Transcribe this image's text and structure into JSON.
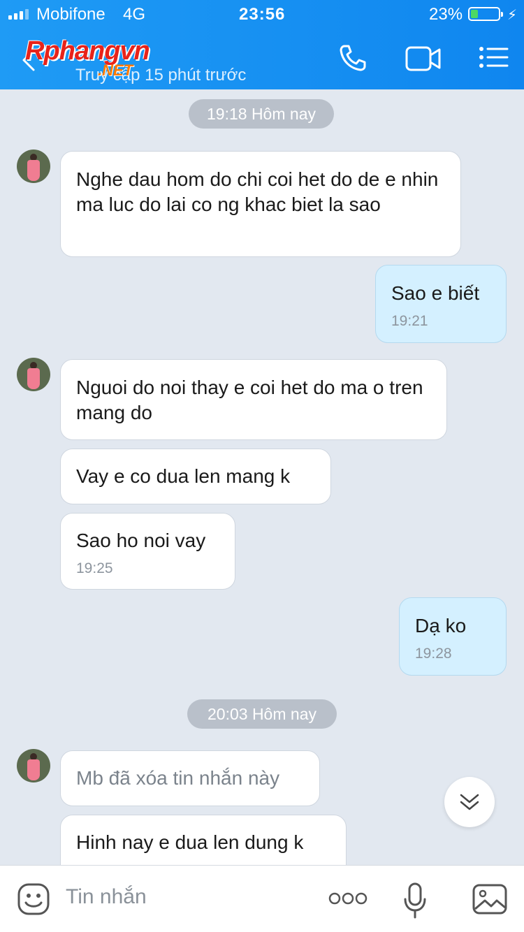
{
  "status": {
    "carrier": "Mobifone",
    "network": "4G",
    "time": "23:56",
    "battery": "23%"
  },
  "header": {
    "logo_main": "Rphangvn",
    "logo_sub": ".NET",
    "subtitle": "Truy cập 15 phút trước"
  },
  "messages": {
    "pill1": "19:18 Hôm nay",
    "m1": "Nghe dau hom do chi coi het do de e nhin ma luc do lai co ng khac biet la sao",
    "m2": "Sao e biết",
    "m2_time": "19:21",
    "m3": "Nguoi do noi thay e coi het do ma o tren mang do",
    "m4": "Vay e co dua len mang k",
    "m5": "Sao ho noi vay",
    "m5_time": "19:25",
    "m6": "Dạ ko",
    "m6_time": "19:28",
    "pill2": "20:03 Hôm nay",
    "m7": "Mb đã xóa tin nhắn này",
    "m8": "Hinh nay e dua len dung k"
  },
  "input": {
    "placeholder": "Tin nhắn"
  },
  "icons": {
    "back": "chevron-left-icon",
    "call": "phone-icon",
    "video": "video-camera-icon",
    "menu": "menu-list-icon",
    "scroll": "double-chevron-down-icon",
    "emoji": "emoji-icon",
    "more": "more-dots-icon",
    "mic": "microphone-icon",
    "image": "image-icon"
  },
  "colors": {
    "header": "#1f9bf5",
    "outgoing_bubble": "#d4f0ff",
    "incoming_bubble": "#ffffff",
    "background": "#e2e8f0"
  }
}
